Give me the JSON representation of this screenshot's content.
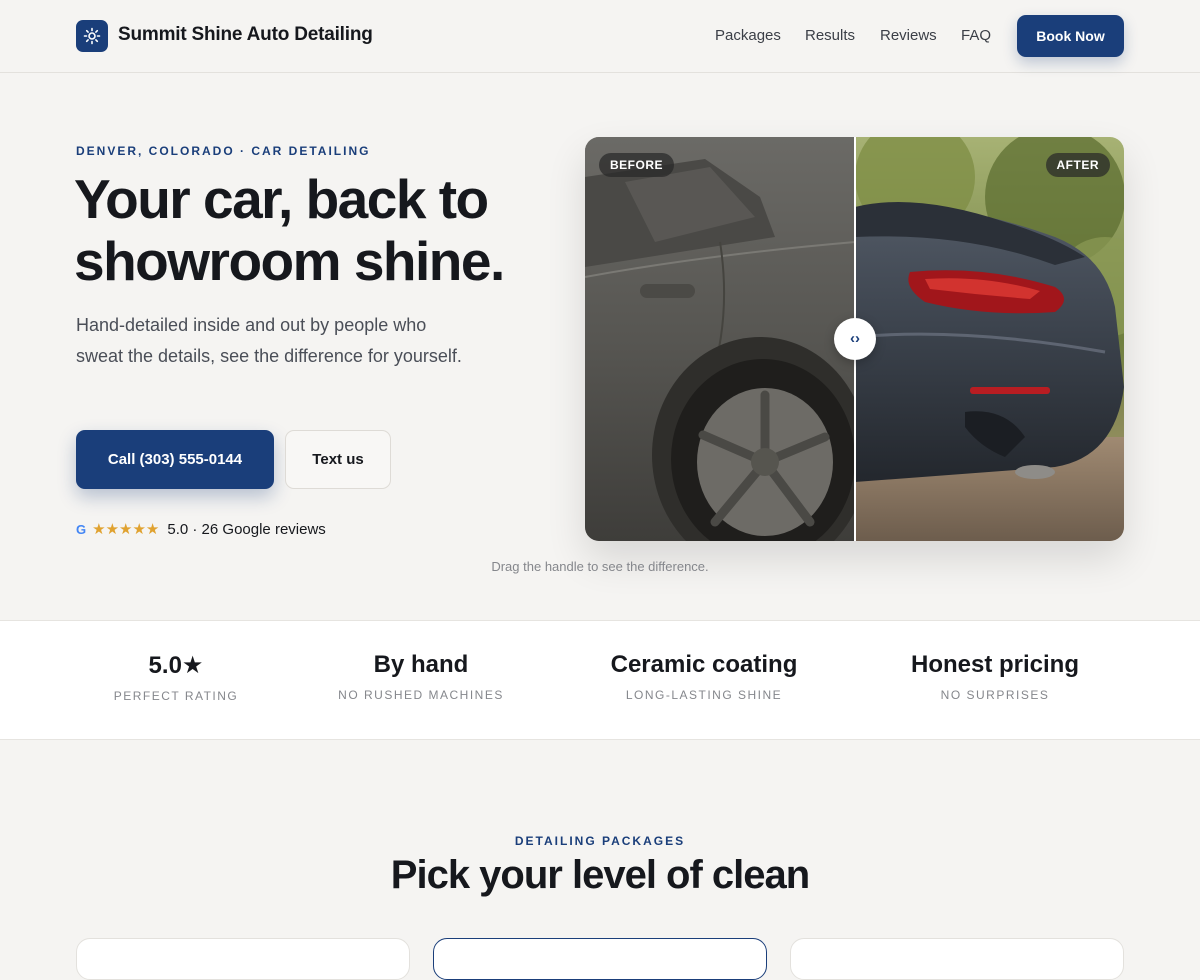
{
  "header": {
    "brand": "Summit Shine Auto Detailing",
    "nav": [
      "Packages",
      "Results",
      "Reviews",
      "FAQ"
    ],
    "cta": "Book Now"
  },
  "hero": {
    "eyebrow": "DENVER, COLORADO · CAR DETAILING",
    "title": "Your car, back to showroom shine.",
    "subtitle": "Hand-detailed inside and out by people who sweat the details, see the difference for yourself.",
    "call_button": "Call (303) 555-0144",
    "text_button": "Text us",
    "google_icon": "G",
    "stars": "★★★★★",
    "rating_text": "5.0 · 26 Google reviews"
  },
  "comparison": {
    "before_label": "BEFORE",
    "after_label": "AFTER",
    "handle_glyph": "‹›",
    "caption": "Drag the handle to see the difference."
  },
  "stats": [
    {
      "value": "5.0★",
      "label": "PERFECT RATING"
    },
    {
      "value": "By hand",
      "label": "NO RUSHED MACHINES"
    },
    {
      "value": "Ceramic coating",
      "label": "LONG-LASTING SHINE"
    },
    {
      "value": "Honest pricing",
      "label": "NO SURPRISES"
    }
  ],
  "packages": {
    "eyebrow": "DETAILING PACKAGES",
    "title": "Pick your level of clean"
  },
  "colors": {
    "accent": "#1a3e7a",
    "background": "#f5f4f2",
    "star": "#e0a230"
  }
}
